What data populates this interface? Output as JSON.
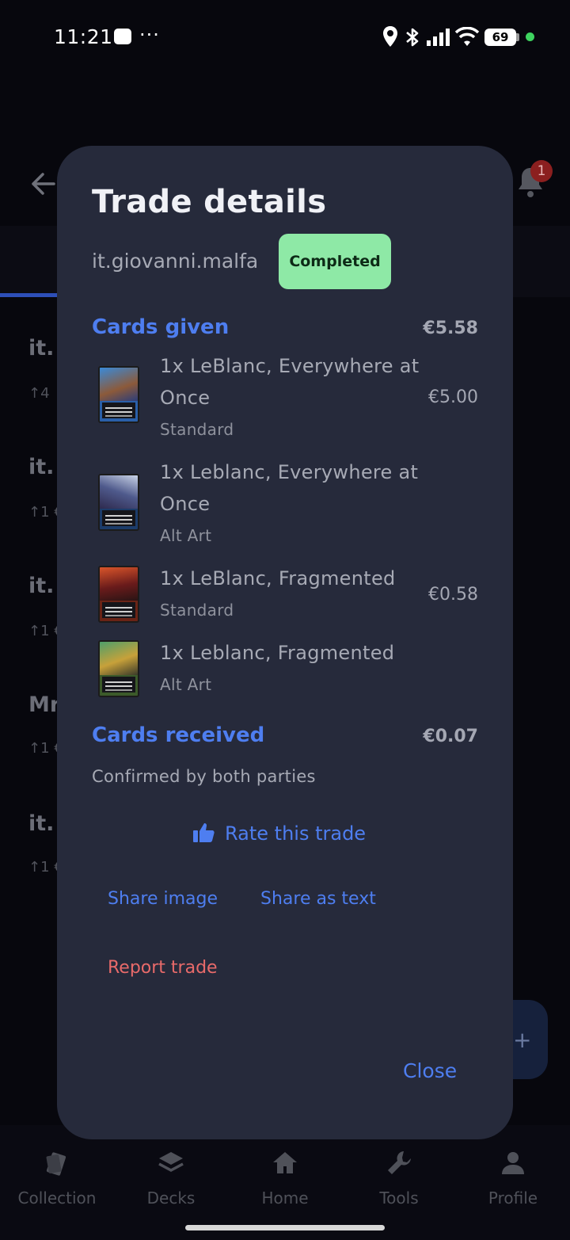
{
  "status_bar": {
    "time": "11:21",
    "more": "···",
    "battery": "69"
  },
  "background": {
    "notification_count": "1",
    "rows": [
      {
        "title": "it.",
        "sub": "↑4"
      },
      {
        "title": "it.",
        "sub": "↑1 €"
      },
      {
        "title": "it.",
        "sub": "↑1 €"
      },
      {
        "title": "Mr",
        "sub": "↑1 €"
      },
      {
        "title": "it.",
        "sub": "↑1 €"
      }
    ]
  },
  "dialog": {
    "title": "Trade details",
    "username": "it.giovanni.malfa",
    "status": "Completed",
    "cards_given": {
      "label": "Cards given",
      "total": "€5.58",
      "items": [
        {
          "name": "1x LeBlanc, Everywhere at Once",
          "variant": "Standard",
          "price": "€5.00"
        },
        {
          "name": "1x Leblanc, Everywhere at Once",
          "variant": "Alt Art",
          "price": ""
        },
        {
          "name": "1x LeBlanc, Fragmented",
          "variant": "Standard",
          "price": "€0.58"
        },
        {
          "name": "1x Leblanc, Fragmented",
          "variant": "Alt Art",
          "price": ""
        }
      ]
    },
    "cards_received": {
      "label": "Cards received",
      "total": "€0.07"
    },
    "confirmation": "Confirmed by both parties",
    "rate_label": "Rate this trade",
    "share_image_label": "Share image",
    "share_text_label": "Share as text",
    "report_label": "Report trade",
    "close_label": "Close"
  },
  "bottom_nav": [
    {
      "label": "Collection",
      "icon": "cards-icon"
    },
    {
      "label": "Decks",
      "icon": "layers-icon"
    },
    {
      "label": "Home",
      "icon": "home-icon"
    },
    {
      "label": "Tools",
      "icon": "wrench-icon"
    },
    {
      "label": "Profile",
      "icon": "person-icon"
    }
  ],
  "colors": {
    "accent": "#4e7ef0",
    "dialog_bg": "#262a3b",
    "completed": "#8ee9a6",
    "danger": "#e86a6a"
  }
}
